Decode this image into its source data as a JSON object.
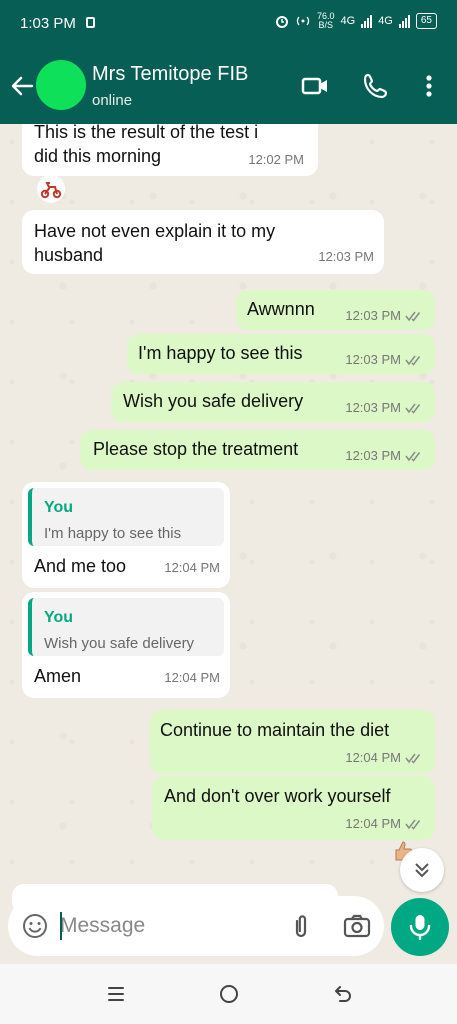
{
  "status_bar": {
    "time": "1:03 PM",
    "speed_value": "76.0",
    "speed_unit": "B/S",
    "network_1": "4G",
    "network_2": "4G",
    "battery": "65"
  },
  "header": {
    "contact_name": "Mrs Temitope FIB",
    "contact_status": "online",
    "avatar_color": "#0fe05a",
    "icons": [
      "back-arrow-icon",
      "video-call-icon",
      "phone-icon",
      "more-vert-icon"
    ]
  },
  "messages": [
    {
      "direction": "in",
      "lines": [
        "This is the result of the test i",
        "did this morning"
      ],
      "time": "12:02 PM"
    },
    {
      "direction": "in",
      "lines": [
        "Have not even explain it to my",
        "husband"
      ],
      "time": "12:03 PM"
    },
    {
      "direction": "out",
      "text": "Awwnnn",
      "time": "12:03 PM"
    },
    {
      "direction": "out",
      "text": "I'm happy to see this",
      "time": "12:03 PM"
    },
    {
      "direction": "out",
      "text": "Wish you safe delivery",
      "time": "12:03 PM"
    },
    {
      "direction": "out",
      "text": "Please stop the treatment",
      "time": "12:03 PM"
    },
    {
      "direction": "in",
      "quote_author": "You",
      "quote_text": "I'm happy to see this",
      "text": "And me too",
      "time": "12:04 PM"
    },
    {
      "direction": "in",
      "quote_author": "You",
      "quote_text": "Wish you safe delivery",
      "text": "Amen",
      "time": "12:04 PM"
    },
    {
      "direction": "out",
      "text": "Continue to maintain the diet",
      "time": "12:04 PM"
    },
    {
      "direction": "out",
      "text": "And don't over work yourself",
      "time": "12:04 PM"
    }
  ],
  "input": {
    "placeholder": "Message"
  },
  "colors": {
    "header_bg": "#075e54",
    "outgoing_bubble": "#dcf8c6",
    "incoming_bubble": "#ffffff",
    "accent": "#00a884",
    "read_ticks": "#8a8a8a"
  }
}
